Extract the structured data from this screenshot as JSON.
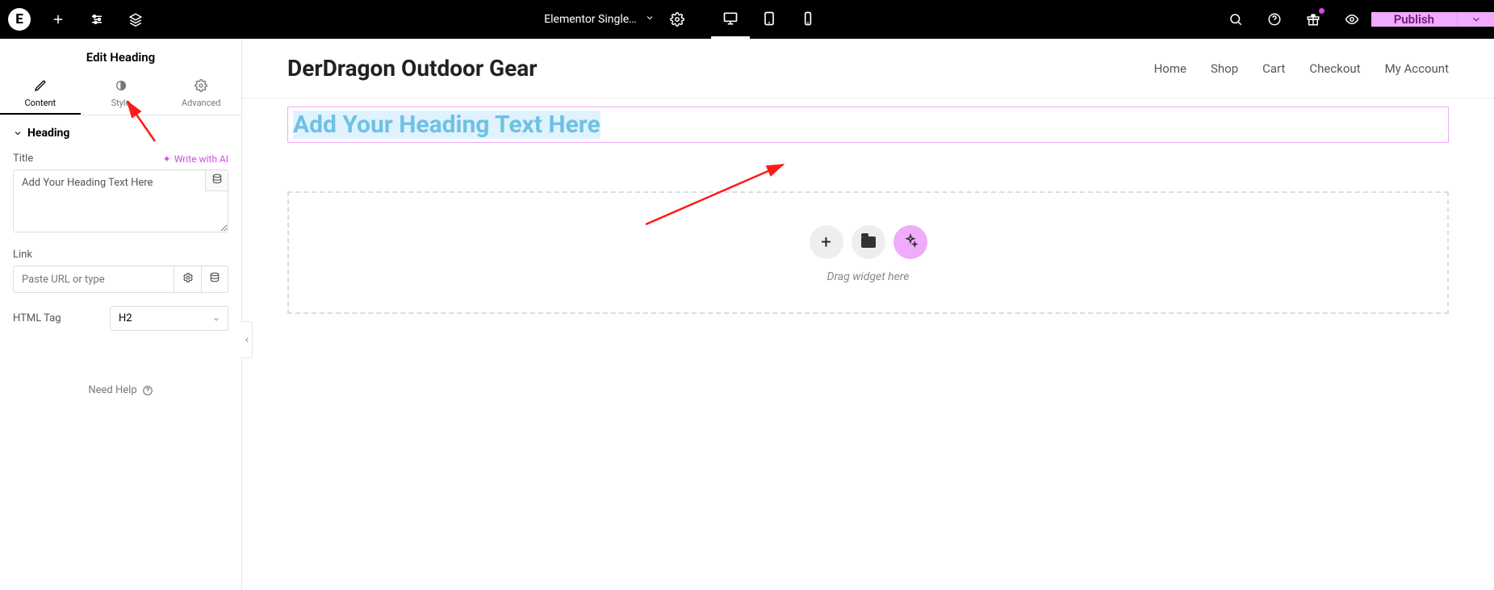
{
  "topbar": {
    "doc_name": "Elementor Single…",
    "publish_label": "Publish"
  },
  "sidebar": {
    "panel_title": "Edit Heading",
    "tabs": {
      "content": "Content",
      "style": "Style",
      "advanced": "Advanced"
    },
    "section_label": "Heading",
    "title_label": "Title",
    "write_ai_label": "Write with AI",
    "title_value": "Add Your Heading Text Here",
    "link_label": "Link",
    "link_placeholder": "Paste URL or type",
    "html_tag_label": "HTML Tag",
    "html_tag_value": "H2",
    "need_help": "Need Help"
  },
  "site": {
    "title": "DerDragon Outdoor Gear",
    "nav": [
      "Home",
      "Shop",
      "Cart",
      "Checkout",
      "My Account"
    ]
  },
  "canvas": {
    "heading_text": "Add Your Heading Text Here",
    "drop_hint": "Drag widget here"
  }
}
